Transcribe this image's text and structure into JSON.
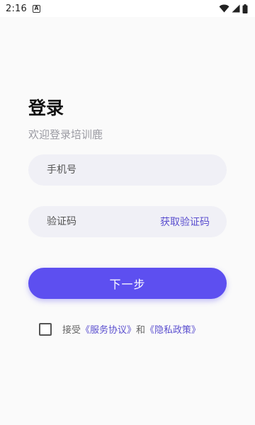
{
  "status_bar": {
    "time": "2:16",
    "notification_glyph": "A",
    "icons": [
      "wifi-icon",
      "signal-icon",
      "battery-icon"
    ]
  },
  "login": {
    "title": "登录",
    "subtitle": "欢迎登录培训鹿",
    "phone_placeholder": "手机号",
    "code_placeholder": "验证码",
    "get_code_label": "获取验证码",
    "next_label": "下一步",
    "agree_prefix": "接受",
    "service_link": "《服务协议》",
    "agree_and": "和",
    "privacy_link": "《隐私政策》"
  },
  "colors": {
    "accent": "#5d4ff0",
    "link": "#5b4fcf",
    "field_bg": "#f0f0f6",
    "page_bg": "#fafafa"
  }
}
